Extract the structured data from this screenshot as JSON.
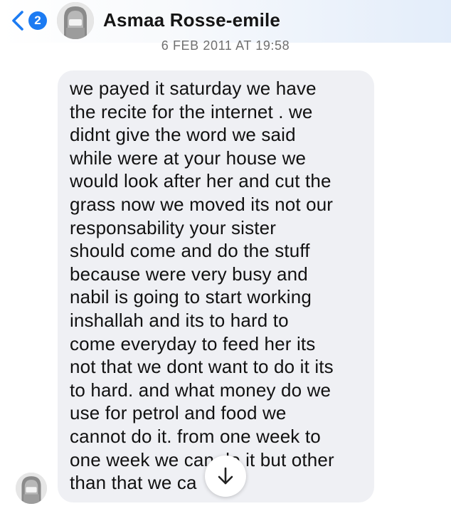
{
  "header": {
    "unread_count": "2",
    "contact_name": "Asmaa Rosse-emile",
    "accent_color": "#1c7bf2"
  },
  "conversation": {
    "timestamp": "6 FEB 2011 AT 19:58",
    "message_text": "we payed it saturday we have\nthe recite for the internet .    we\ndidnt give the word we said\nwhile were at your house we\nwould look after her and cut the\ngrass now we moved its not our\nresponsability your sister\nshould come and do the stuff\nbecause were very busy and\nnabil is going to start working\ninshallah and its to hard to\ncome everyday to feed her its\nnot that we dont want to do it its\nto hard.  and what money do we\nuse for petrol and food we\ncannot do it.  from one week to\none week we can do it but other\nthan that we ca"
  },
  "icons": {
    "back": "chevron-left-icon",
    "scroll": "arrow-down-icon",
    "avatar": "avatar-icon"
  }
}
